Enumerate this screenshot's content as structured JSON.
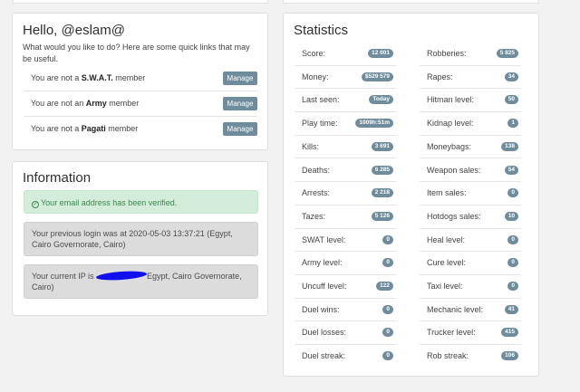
{
  "hello": {
    "title": "Hello, @eslam@",
    "intro": "What would you like to do? Here are some quick links that may be useful.",
    "memberships": [
      {
        "prefix": "You are not a ",
        "group": "S.W.A.T.",
        "suffix": " member",
        "button": "Manage"
      },
      {
        "prefix": "You are not an ",
        "group": "Army",
        "suffix": " member",
        "button": "Manage"
      },
      {
        "prefix": "You are not a ",
        "group": "Pagati",
        "suffix": " member",
        "button": "Manage"
      }
    ]
  },
  "info": {
    "title": "Information",
    "verified": "Your email address has been verified.",
    "last_login": "Your previous login was at 2020-05-03 13:37:21 (Egypt, Cairo Governorate, Cairo)",
    "ip_prefix": "Your current IP is ",
    "ip_suffix": "Egypt, Cairo Governorate, Cairo)",
    "colors": {
      "success": "#38884b",
      "badge": "#6f8c9c",
      "redaction": "#1010ee"
    }
  },
  "statistics": {
    "title": "Statistics",
    "left": [
      {
        "label": "Score:",
        "value": "12 001"
      },
      {
        "label": "Money:",
        "value": "$529 579"
      },
      {
        "label": "Last seen:",
        "value": "Today"
      },
      {
        "label": "Play time:",
        "value": "1009h:51m"
      },
      {
        "label": "Kills:",
        "value": "3 691"
      },
      {
        "label": "Deaths:",
        "value": "6 285"
      },
      {
        "label": "Arrests:",
        "value": "2 218"
      },
      {
        "label": "Tazes:",
        "value": "5 126"
      },
      {
        "label": "SWAT level:",
        "value": "0"
      },
      {
        "label": "Army level:",
        "value": "0"
      },
      {
        "label": "Uncuff level:",
        "value": "122"
      },
      {
        "label": "Duel wins:",
        "value": "0"
      },
      {
        "label": "Duel losses:",
        "value": "0"
      },
      {
        "label": "Duel streak:",
        "value": "0"
      }
    ],
    "right": [
      {
        "label": "Robberies:",
        "value": "5 825"
      },
      {
        "label": "Rapes:",
        "value": "34"
      },
      {
        "label": "Hitman level:",
        "value": "50"
      },
      {
        "label": "Kidnap level:",
        "value": "1"
      },
      {
        "label": "Moneybags:",
        "value": "138"
      },
      {
        "label": "Weapon sales:",
        "value": "54"
      },
      {
        "label": "Item sales:",
        "value": "0"
      },
      {
        "label": "Hotdogs sales:",
        "value": "10"
      },
      {
        "label": "Heal level:",
        "value": "0"
      },
      {
        "label": "Cure level:",
        "value": "0"
      },
      {
        "label": "Taxi level:",
        "value": "0"
      },
      {
        "label": "Mechanic level:",
        "value": "41"
      },
      {
        "label": "Trucker level:",
        "value": "415"
      },
      {
        "label": "Rob streak:",
        "value": "106"
      }
    ]
  }
}
